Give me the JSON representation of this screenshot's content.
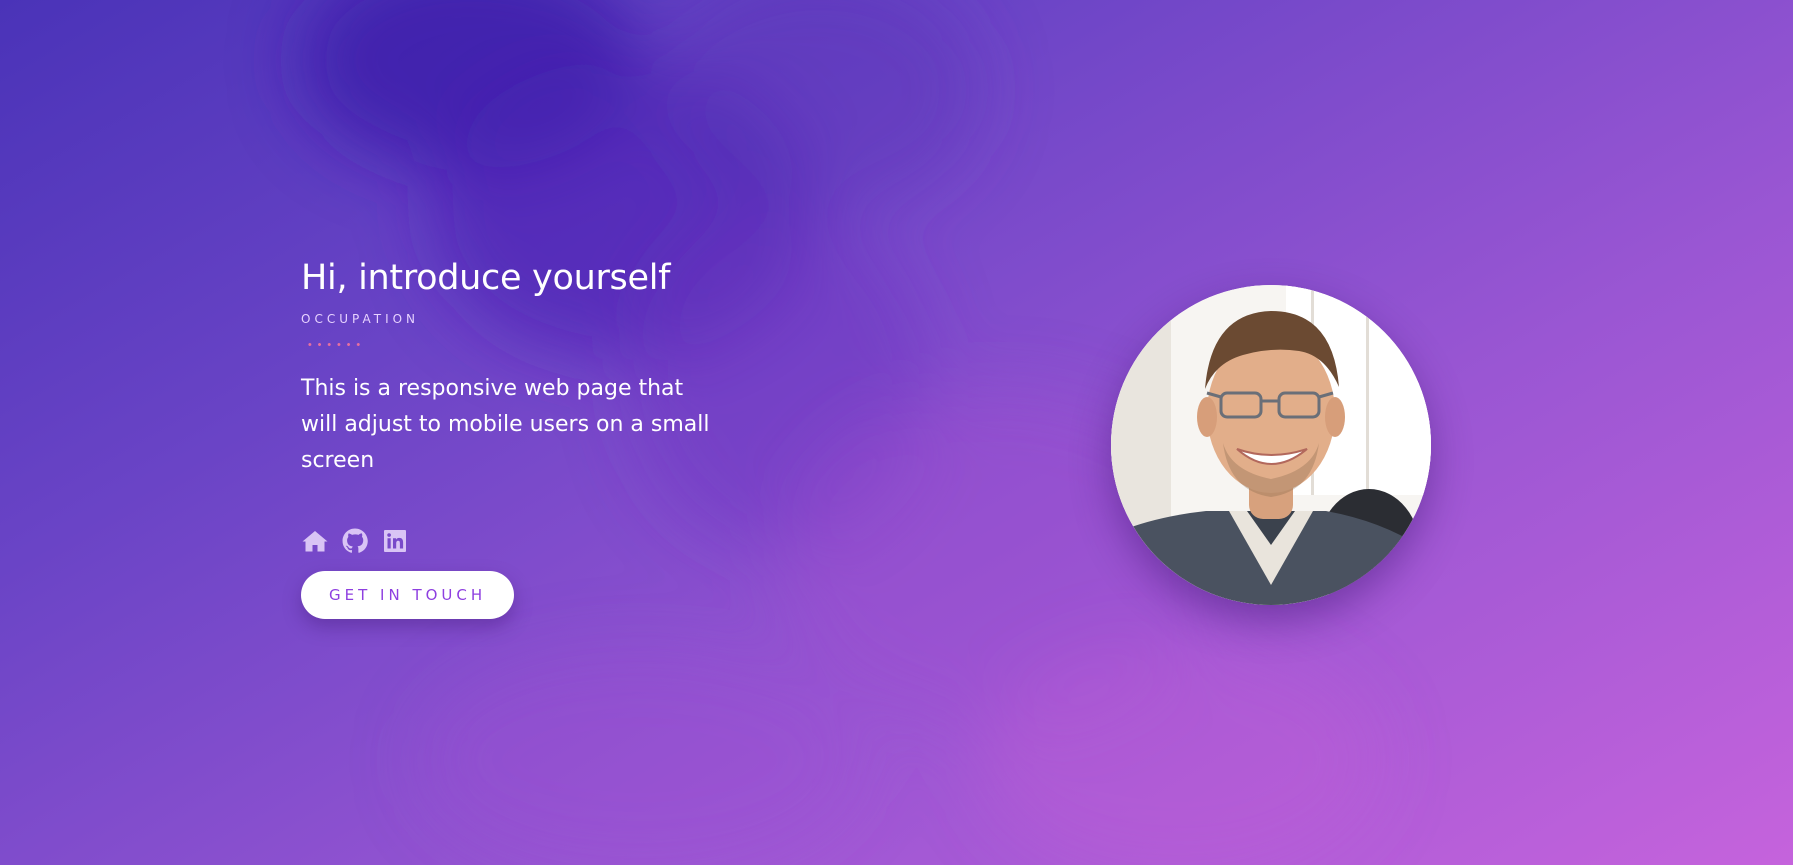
{
  "hero": {
    "title": "Hi, introduce yourself",
    "occupation": "OCCUPATION",
    "bio": "This is a responsive web page that will adjust to mobile users on a small screen"
  },
  "social": {
    "links": [
      {
        "icon": "home-icon"
      },
      {
        "icon": "github-icon"
      },
      {
        "icon": "linkedin-icon"
      }
    ]
  },
  "cta": {
    "label": "GET IN TOUCH"
  },
  "colors": {
    "accent": "#8e3fe0",
    "divider": "#e76fa0",
    "background_start": "#4a33b8",
    "background_end": "#c563dc"
  }
}
